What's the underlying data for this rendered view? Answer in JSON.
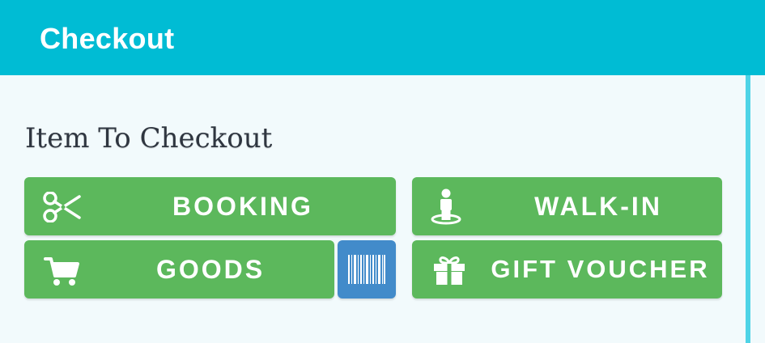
{
  "appbar": {
    "title": "Checkout"
  },
  "section": {
    "title": "Item To Checkout"
  },
  "buttons": {
    "booking": {
      "label": "BOOKING",
      "icon": "scissors-icon"
    },
    "walkin": {
      "label": "WALK-IN",
      "icon": "person-standing-icon"
    },
    "goods": {
      "label": "GOODS",
      "icon": "shopping-cart-icon"
    },
    "barcode": {
      "icon": "barcode-icon"
    },
    "gift": {
      "label": "GIFT VOUCHER",
      "icon": "gift-icon"
    }
  },
  "colors": {
    "appbar": "#00bcd4",
    "button_green": "#5cb85c",
    "barcode_blue": "#428bca",
    "background": "#f2fafc"
  }
}
